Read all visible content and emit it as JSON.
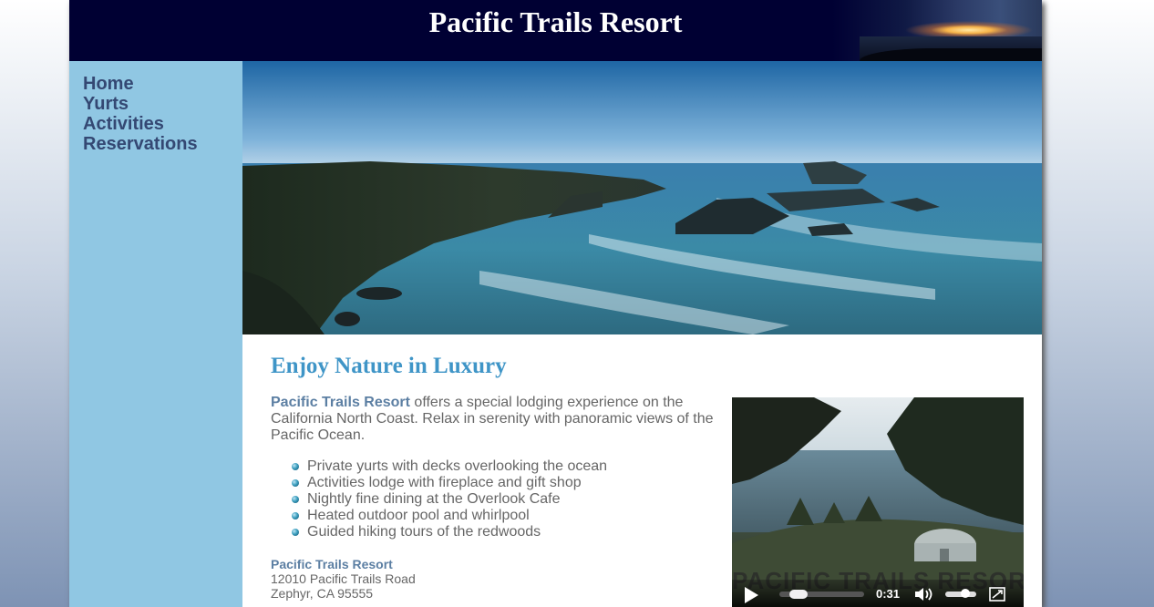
{
  "header": {
    "title": "Pacific Trails Resort"
  },
  "nav": {
    "items": [
      {
        "label": "Home"
      },
      {
        "label": "Yurts"
      },
      {
        "label": "Activities"
      },
      {
        "label": "Reservations"
      }
    ]
  },
  "main": {
    "heading": "Enjoy Nature in Luxury",
    "intro_name": "Pacific Trails Resort",
    "intro_text": " offers a special lodging experience on the California North Coast. Relax in serenity with panoramic views of the Pacific Ocean.",
    "features": [
      "Private yurts with decks overlooking the ocean",
      "Activities lodge with fireplace and gift shop",
      "Nightly fine dining at the Overlook Cafe",
      "Heated outdoor pool and whirlpool",
      "Guided hiking tours of the redwoods"
    ],
    "address": {
      "name": "Pacific Trails Resort",
      "street": "12010 Pacific Trails Road",
      "city": "Zephyr, CA 95555"
    }
  },
  "video": {
    "watermark": "PACIFIC TRAILS RESORT",
    "time": "0:31",
    "progress": 0.15,
    "volume": 0.7
  },
  "colors": {
    "header_bg": "#000033",
    "nav_bg": "#90c7e3",
    "nav_link": "#344873",
    "heading": "#3f95c7",
    "accent_text": "#5c7fa3"
  }
}
